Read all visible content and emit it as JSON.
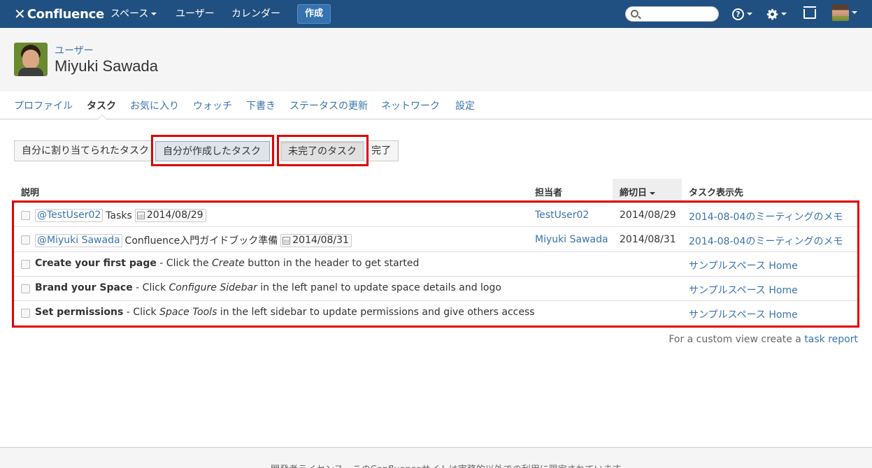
{
  "topbar": {
    "brand": "Confluence",
    "nav": [
      "スペース",
      "ユーザー",
      "カレンダー"
    ],
    "create_label": "作成",
    "search_placeholder": "",
    "help_glyph": "?"
  },
  "header": {
    "breadcrumb": "ユーザー",
    "title": "Miyuki Sawada"
  },
  "tabs": [
    "プロファイル",
    "タスク",
    "お気に入り",
    "ウォッチ",
    "下書き",
    "ステータスの更新",
    "ネットワーク",
    "設定"
  ],
  "filters": [
    "自分に割り当てられたタスク",
    "自分が作成したタスク",
    "未完了のタスク",
    "完了"
  ],
  "table": {
    "headers": [
      "説明",
      "担当者",
      "締切日",
      "タスク表示先"
    ],
    "rows": [
      {
        "mention": "@TestUser02",
        "text": "Tasks",
        "date": "2014/08/29",
        "assignee": "TestUser02",
        "due": "2014/08/29",
        "location": "2014-08-04のミーティングのメモ"
      },
      {
        "mention": "@Miyuki Sawada",
        "text": "Confluence入門ガイドブック準備",
        "date": "2014/08/31",
        "assignee": "Miyuki Sawada",
        "due": "2014/08/31",
        "location": "2014-08-04のミーティングのメモ"
      },
      {
        "bold": "Create your first page",
        "pre": " - Click the ",
        "em": "Create",
        "post": " button in the header to get started",
        "location": "サンプルスペース Home"
      },
      {
        "bold": "Brand your Space",
        "pre": " - Click ",
        "em": "Configure Sidebar",
        "post": " in the left panel to update space details and logo",
        "location": "サンプルスペース Home"
      },
      {
        "bold": "Set permissions",
        "pre": " - Click ",
        "em": "Space Tools",
        "post": " in the left sidebar to update permissions and give others access",
        "location": "サンプルスペース Home"
      }
    ]
  },
  "note": {
    "prefix": "For a custom view create a ",
    "link": "task report"
  },
  "footer": "開発者ライセンス - このConfluenceサイトは実務的以外での利用に限定されています。",
  "colors": {
    "topbar": "#205081",
    "link": "#3b73af",
    "highlight": "#e00000"
  }
}
